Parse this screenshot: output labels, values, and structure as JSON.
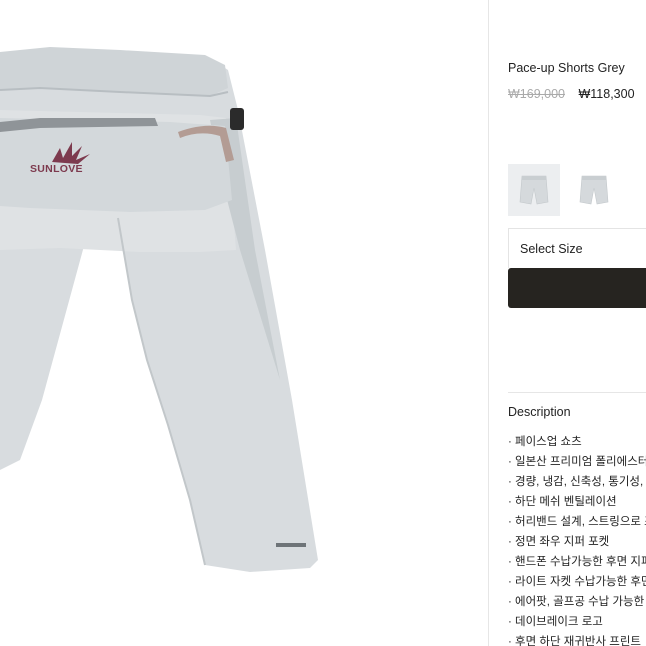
{
  "gallery": {
    "brand_logo_text": "SUNLOVE",
    "colors": {
      "fabric": "#d6dbdd",
      "fabric_shadow": "#c4c9cc",
      "strap": "#b39c94",
      "logo": "#7d3a4e"
    }
  },
  "product": {
    "title": "Pace-up Shorts Grey",
    "original_price": "₩169,000",
    "sale_price": "₩118,300"
  },
  "thumbnails": [
    {
      "label": "back-view",
      "active": true
    },
    {
      "label": "front-view",
      "active": false
    }
  ],
  "size_select": {
    "label": "Select Size"
  },
  "buy_button": {
    "color": "#262420"
  },
  "description": {
    "heading": "Description",
    "items": [
      "· 페이스업 쇼츠",
      "· 일본산 프리미엄 폴리에스터",
      "· 경량, 냉감, 신축성, 통기성, 속건",
      "· 하단 메쉬 벤틸레이션",
      "· 허리밴드 설계, 스트링으로 조절",
      "· 정면 좌우 지퍼 포켓",
      "· 핸드폰 수납가능한 후면 지퍼 포켓",
      "· 라이트 자켓 수납가능한 후면 포켓",
      "· 에어팟, 골프공 수납 가능한 포켓",
      "· 데이브레이크 로고",
      "· 후면 하단 재귀반사 프린트"
    ]
  }
}
